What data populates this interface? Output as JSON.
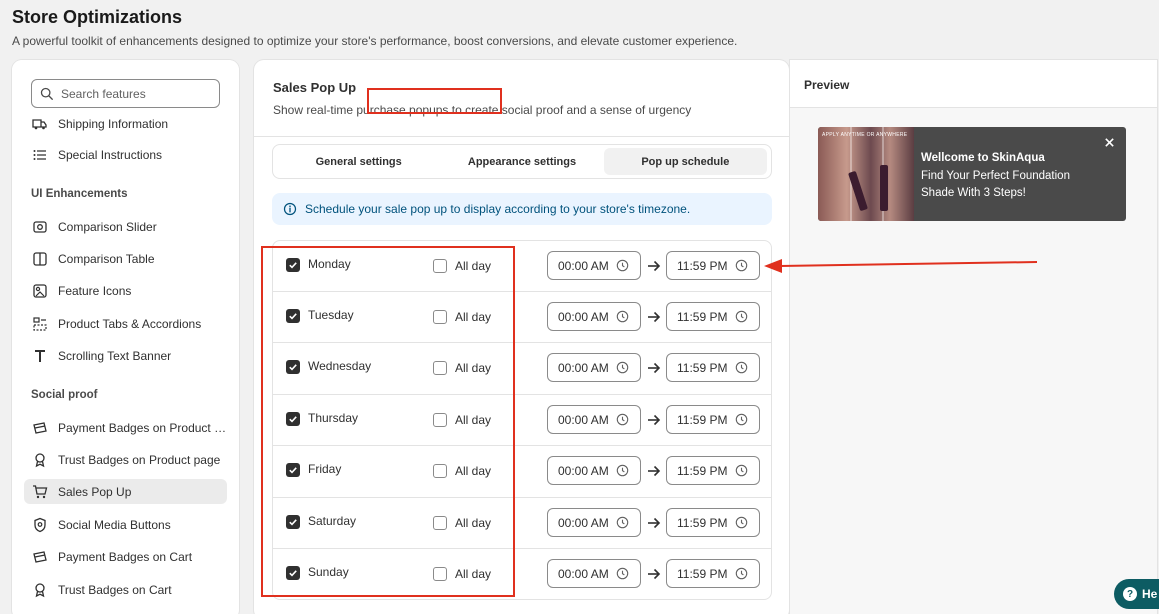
{
  "page": {
    "title": "Store Optimizations",
    "subtitle": "A powerful toolkit of enhancements designed to optimize your store's performance, boost conversions, and elevate customer experience."
  },
  "sidebar": {
    "search_placeholder": "Search features",
    "partial_item": "Shipping Information",
    "items_top": [
      {
        "label": "Special Instructions",
        "icon": "list-icon"
      }
    ],
    "section_ui": "UI Enhancements",
    "items_ui": [
      {
        "label": "Comparison Slider",
        "icon": "slider-icon"
      },
      {
        "label": "Comparison Table",
        "icon": "table-icon"
      },
      {
        "label": "Feature Icons",
        "icon": "feature-icon"
      },
      {
        "label": "Product Tabs & Accordions",
        "icon": "tabs-icon"
      },
      {
        "label": "Scrolling Text Banner",
        "icon": "text-icon"
      }
    ],
    "section_social": "Social proof",
    "items_social": [
      {
        "label": "Payment Badges on Product page",
        "icon": "payment-icon"
      },
      {
        "label": "Trust Badges on Product page",
        "icon": "badge-icon"
      },
      {
        "label": "Sales Pop Up",
        "icon": "cart-icon",
        "active": true
      },
      {
        "label": "Social Media Buttons",
        "icon": "shield-icon"
      },
      {
        "label": "Payment Badges on Cart",
        "icon": "payment-icon"
      },
      {
        "label": "Trust Badges on Cart",
        "icon": "badge-icon"
      }
    ]
  },
  "main": {
    "title": "Sales Pop Up",
    "description": "Show real-time purchase popups to create social proof and a sense of urgency",
    "tabs": [
      {
        "label": "General settings"
      },
      {
        "label": "Appearance settings"
      },
      {
        "label": "Pop up schedule",
        "active": true
      }
    ],
    "info_text": "Schedule your sale pop up to display according to your store's timezone.",
    "all_day_label": "All day",
    "schedule": [
      {
        "day": "Monday",
        "start": "00:00 AM",
        "end": "11:59 PM",
        "enabled": true,
        "all_day": false
      },
      {
        "day": "Tuesday",
        "start": "00:00 AM",
        "end": "11:59 PM",
        "enabled": true,
        "all_day": false
      },
      {
        "day": "Wednesday",
        "start": "00:00 AM",
        "end": "11:59 PM",
        "enabled": true,
        "all_day": false
      },
      {
        "day": "Thursday",
        "start": "00:00 AM",
        "end": "11:59 PM",
        "enabled": true,
        "all_day": false
      },
      {
        "day": "Friday",
        "start": "00:00 AM",
        "end": "11:59 PM",
        "enabled": true,
        "all_day": false
      },
      {
        "day": "Saturday",
        "start": "00:00 AM",
        "end": "11:59 PM",
        "enabled": true,
        "all_day": false
      },
      {
        "day": "Sunday",
        "start": "00:00 AM",
        "end": "11:59 PM",
        "enabled": true,
        "all_day": false
      }
    ]
  },
  "preview": {
    "title": "Preview",
    "popup": {
      "image_caption": "APPLY ANYTIME OR ANYWHERE",
      "line1": "Wellcome to SkinAqua",
      "line2": "Find Your Perfect Foundation Shade With 3 Steps!"
    }
  },
  "help": {
    "label": "He"
  },
  "colors": {
    "annotation": "#e0301e",
    "popup_bg": "#4a4a4a",
    "info_bg": "#eaf4ff"
  }
}
